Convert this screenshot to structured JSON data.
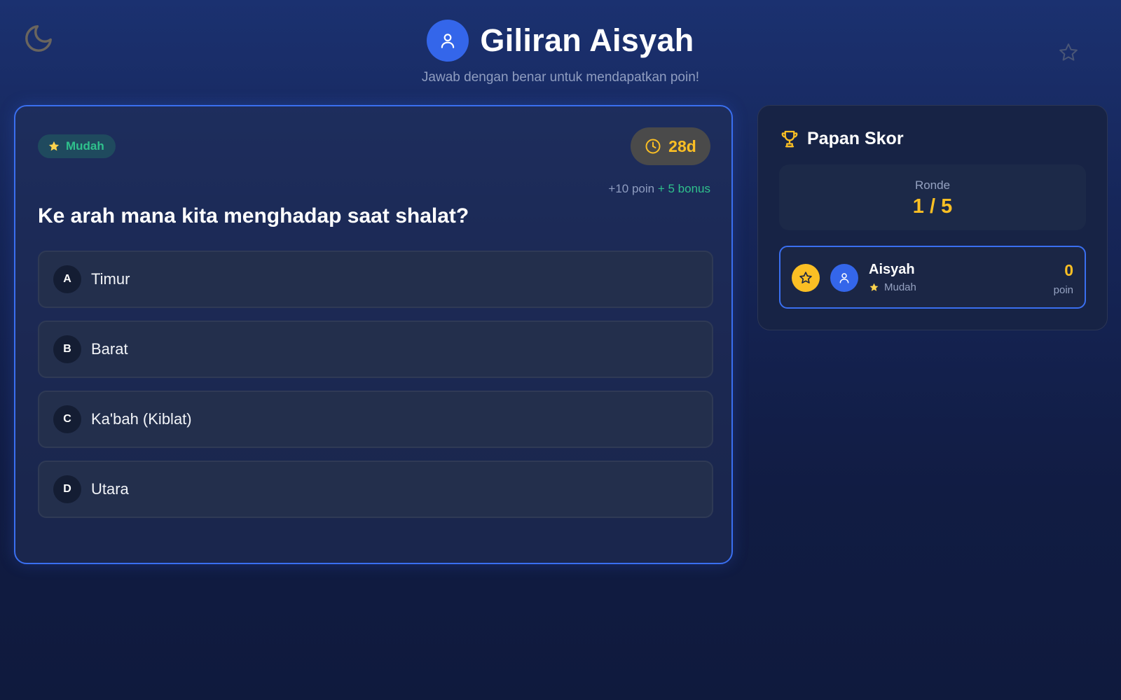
{
  "header": {
    "title": "Giliran Aisyah",
    "subtitle": "Jawab dengan benar untuk mendapatkan poin!"
  },
  "question_card": {
    "difficulty": "Mudah",
    "timer": "28d",
    "points": "+10 poin",
    "bonus": "+ 5 bonus",
    "question": "Ke arah mana kita menghadap saat shalat?",
    "options": [
      {
        "letter": "A",
        "text": "Timur"
      },
      {
        "letter": "B",
        "text": "Barat"
      },
      {
        "letter": "C",
        "text": "Ka'bah (Kiblat)"
      },
      {
        "letter": "D",
        "text": "Utara"
      }
    ]
  },
  "scoreboard": {
    "title": "Papan Skor",
    "round_label": "Ronde",
    "round_value": "1 / 5",
    "players": [
      {
        "name": "Aisyah",
        "difficulty": "Mudah",
        "score": "0",
        "unit": "poin"
      }
    ]
  },
  "icons": {
    "theme_toggle": "moon-icon",
    "favorite": "star-outline-icon",
    "avatar": "user-icon",
    "timer": "clock-icon",
    "scoreboard": "trophy-icon",
    "difficulty": "star-icon"
  },
  "colors": {
    "accent": "#3466ea",
    "gold": "#fbbf24",
    "success": "#2fc18c"
  }
}
